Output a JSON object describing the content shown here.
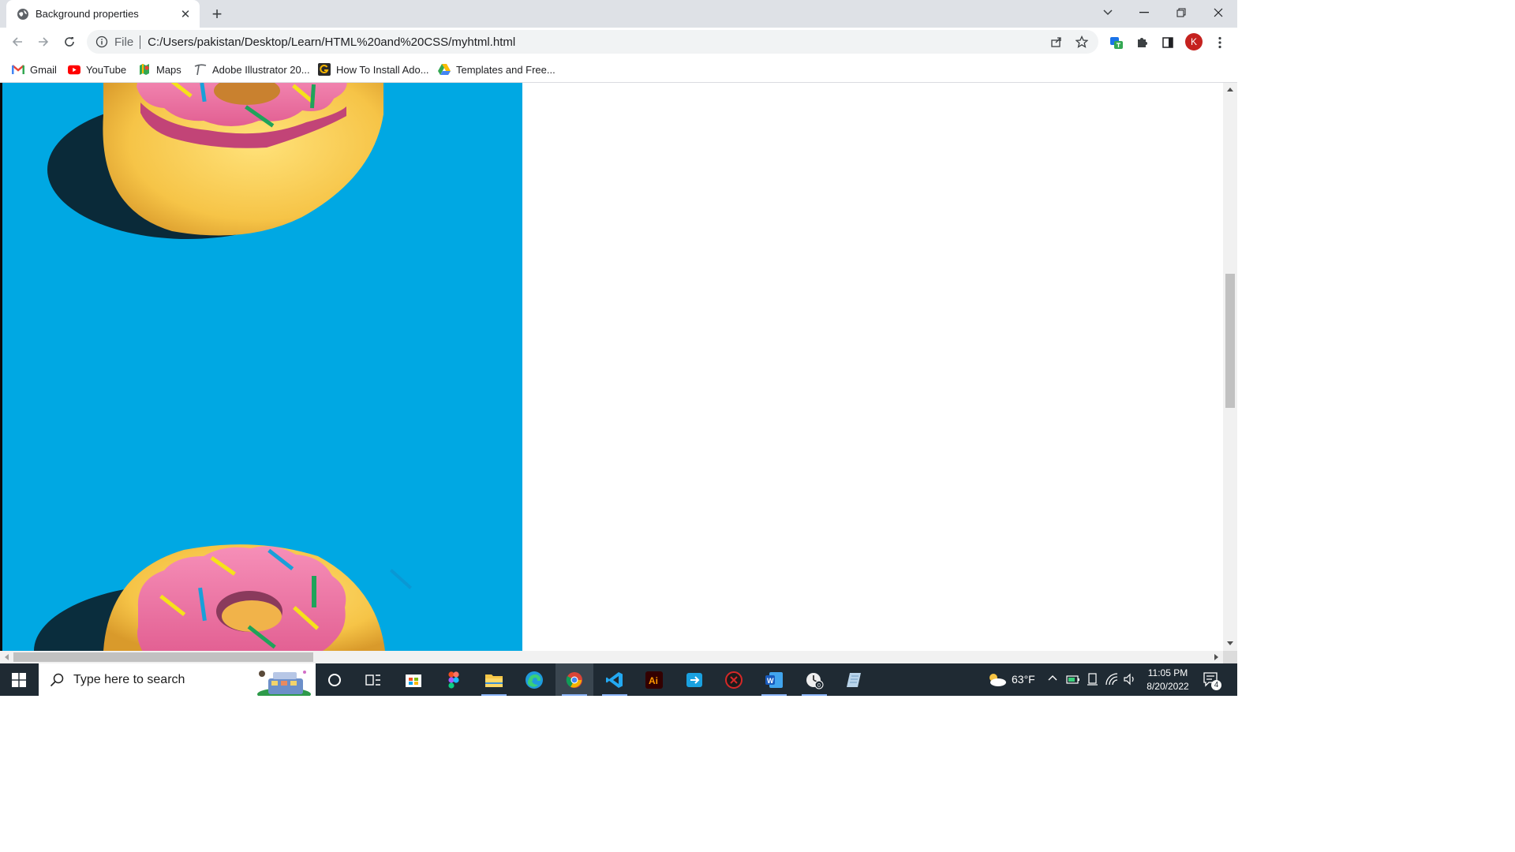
{
  "browser": {
    "tab": {
      "title": "Background properties",
      "favicon": "globe-icon"
    },
    "address_bar": {
      "scheme_label": "File",
      "url": "C:/Users/pakistan/Desktop/Learn/HTML%20and%20CSS/myhtml.html"
    },
    "profile_initial": "K",
    "bookmarks": [
      {
        "label": "Gmail",
        "icon": "gmail-icon"
      },
      {
        "label": "YouTube",
        "icon": "youtube-icon"
      },
      {
        "label": "Maps",
        "icon": "maps-icon"
      },
      {
        "label": "Adobe Illustrator 20...",
        "icon": "pen-icon"
      },
      {
        "label": "How To Install Ado...",
        "icon": "g-icon"
      },
      {
        "label": "Templates and Free...",
        "icon": "google-drive-icon"
      }
    ]
  },
  "page": {
    "background_color": "#00a8e3",
    "image": "donut-image"
  },
  "taskbar": {
    "search_placeholder": "Type here to search",
    "apps": [
      "cortana-icon",
      "task-view-icon",
      "store-icon",
      "figma-icon",
      "file-explorer-icon",
      "edge-icon",
      "chrome-icon",
      "vscode-icon",
      "illustrator-icon",
      "snip-icon",
      "app-red-icon",
      "word-icon",
      "alarm-icon",
      "notepad-icon"
    ],
    "weather": "63°F",
    "time": "11:05 PM",
    "date": "8/20/2022",
    "notifications_count": "4"
  }
}
